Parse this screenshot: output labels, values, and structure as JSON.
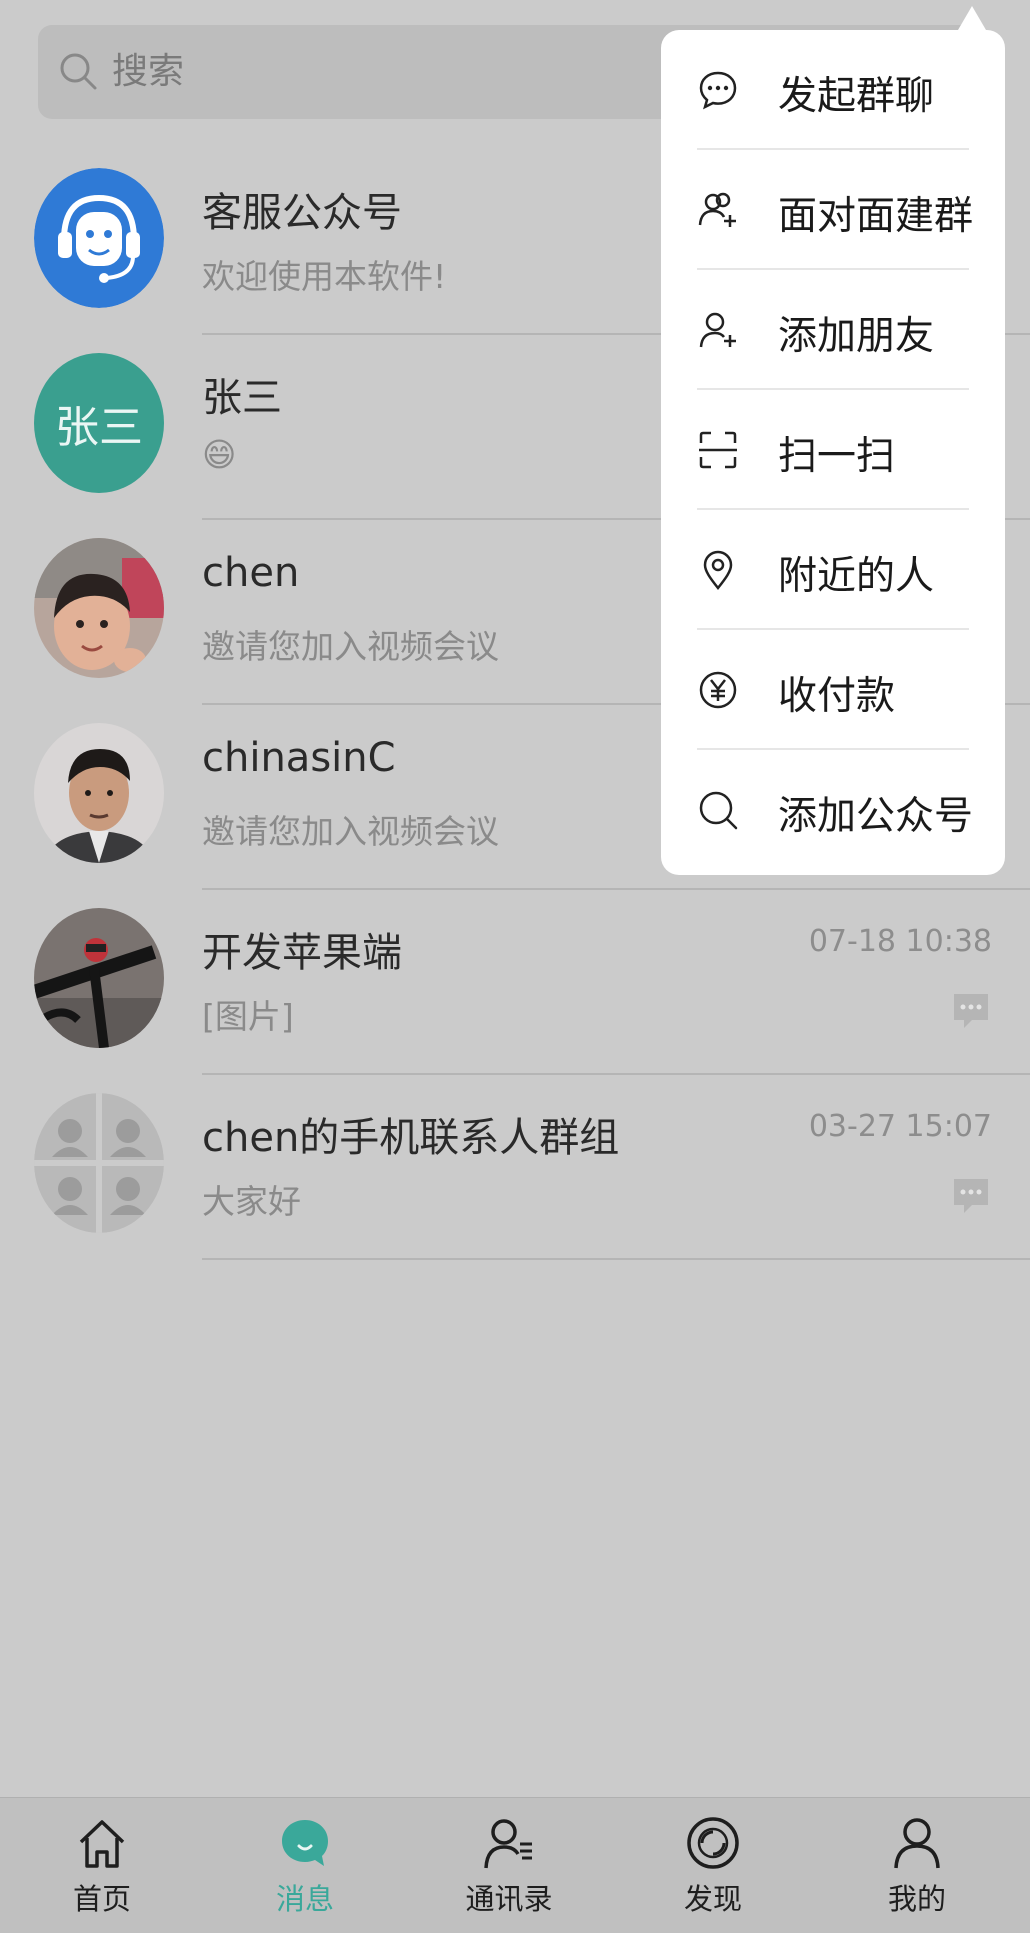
{
  "search": {
    "placeholder": "搜索"
  },
  "conversations": [
    {
      "name": "客服公众号",
      "preview": "欢迎使用本软件!",
      "time": "",
      "avatar": "headset-avatar"
    },
    {
      "name": "张三",
      "preview": "😄",
      "time": "",
      "avatar_text": "张三"
    },
    {
      "name": "chen",
      "preview": "邀请您加入视频会议",
      "time": "",
      "avatar": "photo-girl"
    },
    {
      "name": "chinasinC",
      "preview": "邀请您加入视频会议",
      "time": "",
      "avatar": "photo-man"
    },
    {
      "name": "开发苹果端",
      "preview": "[图片]",
      "time": "07-18 10:38",
      "avatar": "photo-bike"
    },
    {
      "name": "chen的手机联系人群组",
      "preview": "大家好",
      "time": "03-27 15:07",
      "avatar": "group-avatar"
    }
  ],
  "popup_menu": {
    "items": [
      {
        "label": "发起群聊",
        "icon": "chat-bubble-icon"
      },
      {
        "label": "面对面建群",
        "icon": "group-add-icon"
      },
      {
        "label": "添加朋友",
        "icon": "add-friend-icon"
      },
      {
        "label": "扫一扫",
        "icon": "scan-icon"
      },
      {
        "label": "附近的人",
        "icon": "location-pin-icon"
      },
      {
        "label": "收付款",
        "icon": "yen-icon"
      },
      {
        "label": "添加公众号",
        "icon": "search-icon"
      }
    ]
  },
  "bottom_nav": {
    "items": [
      {
        "label": "首页",
        "icon": "home-icon",
        "active": false
      },
      {
        "label": "消息",
        "icon": "message-icon",
        "active": true
      },
      {
        "label": "通讯录",
        "icon": "contacts-icon",
        "active": false
      },
      {
        "label": "发现",
        "icon": "discover-icon",
        "active": false
      },
      {
        "label": "我的",
        "icon": "profile-icon",
        "active": false
      }
    ]
  },
  "colors": {
    "accent": "#3aa89a",
    "overlay_background": "#cbcbcb",
    "headset_avatar": "#2f7ad6",
    "zhangsan_avatar": "#3a9f8f"
  }
}
